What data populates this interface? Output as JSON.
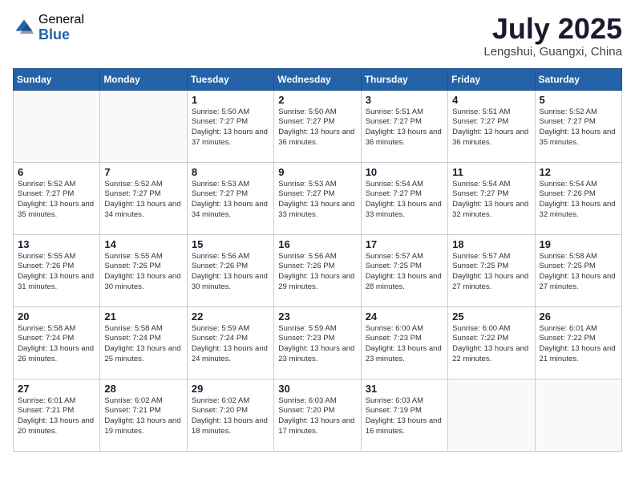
{
  "header": {
    "logo_general": "General",
    "logo_blue": "Blue",
    "month_title": "July 2025",
    "location": "Lengshui, Guangxi, China"
  },
  "weekdays": [
    "Sunday",
    "Monday",
    "Tuesday",
    "Wednesday",
    "Thursday",
    "Friday",
    "Saturday"
  ],
  "weeks": [
    [
      {
        "day": "",
        "detail": ""
      },
      {
        "day": "",
        "detail": ""
      },
      {
        "day": "1",
        "detail": "Sunrise: 5:50 AM\nSunset: 7:27 PM\nDaylight: 13 hours and 37 minutes."
      },
      {
        "day": "2",
        "detail": "Sunrise: 5:50 AM\nSunset: 7:27 PM\nDaylight: 13 hours and 36 minutes."
      },
      {
        "day": "3",
        "detail": "Sunrise: 5:51 AM\nSunset: 7:27 PM\nDaylight: 13 hours and 36 minutes."
      },
      {
        "day": "4",
        "detail": "Sunrise: 5:51 AM\nSunset: 7:27 PM\nDaylight: 13 hours and 36 minutes."
      },
      {
        "day": "5",
        "detail": "Sunrise: 5:52 AM\nSunset: 7:27 PM\nDaylight: 13 hours and 35 minutes."
      }
    ],
    [
      {
        "day": "6",
        "detail": "Sunrise: 5:52 AM\nSunset: 7:27 PM\nDaylight: 13 hours and 35 minutes."
      },
      {
        "day": "7",
        "detail": "Sunrise: 5:52 AM\nSunset: 7:27 PM\nDaylight: 13 hours and 34 minutes."
      },
      {
        "day": "8",
        "detail": "Sunrise: 5:53 AM\nSunset: 7:27 PM\nDaylight: 13 hours and 34 minutes."
      },
      {
        "day": "9",
        "detail": "Sunrise: 5:53 AM\nSunset: 7:27 PM\nDaylight: 13 hours and 33 minutes."
      },
      {
        "day": "10",
        "detail": "Sunrise: 5:54 AM\nSunset: 7:27 PM\nDaylight: 13 hours and 33 minutes."
      },
      {
        "day": "11",
        "detail": "Sunrise: 5:54 AM\nSunset: 7:27 PM\nDaylight: 13 hours and 32 minutes."
      },
      {
        "day": "12",
        "detail": "Sunrise: 5:54 AM\nSunset: 7:26 PM\nDaylight: 13 hours and 32 minutes."
      }
    ],
    [
      {
        "day": "13",
        "detail": "Sunrise: 5:55 AM\nSunset: 7:26 PM\nDaylight: 13 hours and 31 minutes."
      },
      {
        "day": "14",
        "detail": "Sunrise: 5:55 AM\nSunset: 7:26 PM\nDaylight: 13 hours and 30 minutes."
      },
      {
        "day": "15",
        "detail": "Sunrise: 5:56 AM\nSunset: 7:26 PM\nDaylight: 13 hours and 30 minutes."
      },
      {
        "day": "16",
        "detail": "Sunrise: 5:56 AM\nSunset: 7:26 PM\nDaylight: 13 hours and 29 minutes."
      },
      {
        "day": "17",
        "detail": "Sunrise: 5:57 AM\nSunset: 7:25 PM\nDaylight: 13 hours and 28 minutes."
      },
      {
        "day": "18",
        "detail": "Sunrise: 5:57 AM\nSunset: 7:25 PM\nDaylight: 13 hours and 27 minutes."
      },
      {
        "day": "19",
        "detail": "Sunrise: 5:58 AM\nSunset: 7:25 PM\nDaylight: 13 hours and 27 minutes."
      }
    ],
    [
      {
        "day": "20",
        "detail": "Sunrise: 5:58 AM\nSunset: 7:24 PM\nDaylight: 13 hours and 26 minutes."
      },
      {
        "day": "21",
        "detail": "Sunrise: 5:58 AM\nSunset: 7:24 PM\nDaylight: 13 hours and 25 minutes."
      },
      {
        "day": "22",
        "detail": "Sunrise: 5:59 AM\nSunset: 7:24 PM\nDaylight: 13 hours and 24 minutes."
      },
      {
        "day": "23",
        "detail": "Sunrise: 5:59 AM\nSunset: 7:23 PM\nDaylight: 13 hours and 23 minutes."
      },
      {
        "day": "24",
        "detail": "Sunrise: 6:00 AM\nSunset: 7:23 PM\nDaylight: 13 hours and 23 minutes."
      },
      {
        "day": "25",
        "detail": "Sunrise: 6:00 AM\nSunset: 7:22 PM\nDaylight: 13 hours and 22 minutes."
      },
      {
        "day": "26",
        "detail": "Sunrise: 6:01 AM\nSunset: 7:22 PM\nDaylight: 13 hours and 21 minutes."
      }
    ],
    [
      {
        "day": "27",
        "detail": "Sunrise: 6:01 AM\nSunset: 7:21 PM\nDaylight: 13 hours and 20 minutes."
      },
      {
        "day": "28",
        "detail": "Sunrise: 6:02 AM\nSunset: 7:21 PM\nDaylight: 13 hours and 19 minutes."
      },
      {
        "day": "29",
        "detail": "Sunrise: 6:02 AM\nSunset: 7:20 PM\nDaylight: 13 hours and 18 minutes."
      },
      {
        "day": "30",
        "detail": "Sunrise: 6:03 AM\nSunset: 7:20 PM\nDaylight: 13 hours and 17 minutes."
      },
      {
        "day": "31",
        "detail": "Sunrise: 6:03 AM\nSunset: 7:19 PM\nDaylight: 13 hours and 16 minutes."
      },
      {
        "day": "",
        "detail": ""
      },
      {
        "day": "",
        "detail": ""
      }
    ]
  ]
}
